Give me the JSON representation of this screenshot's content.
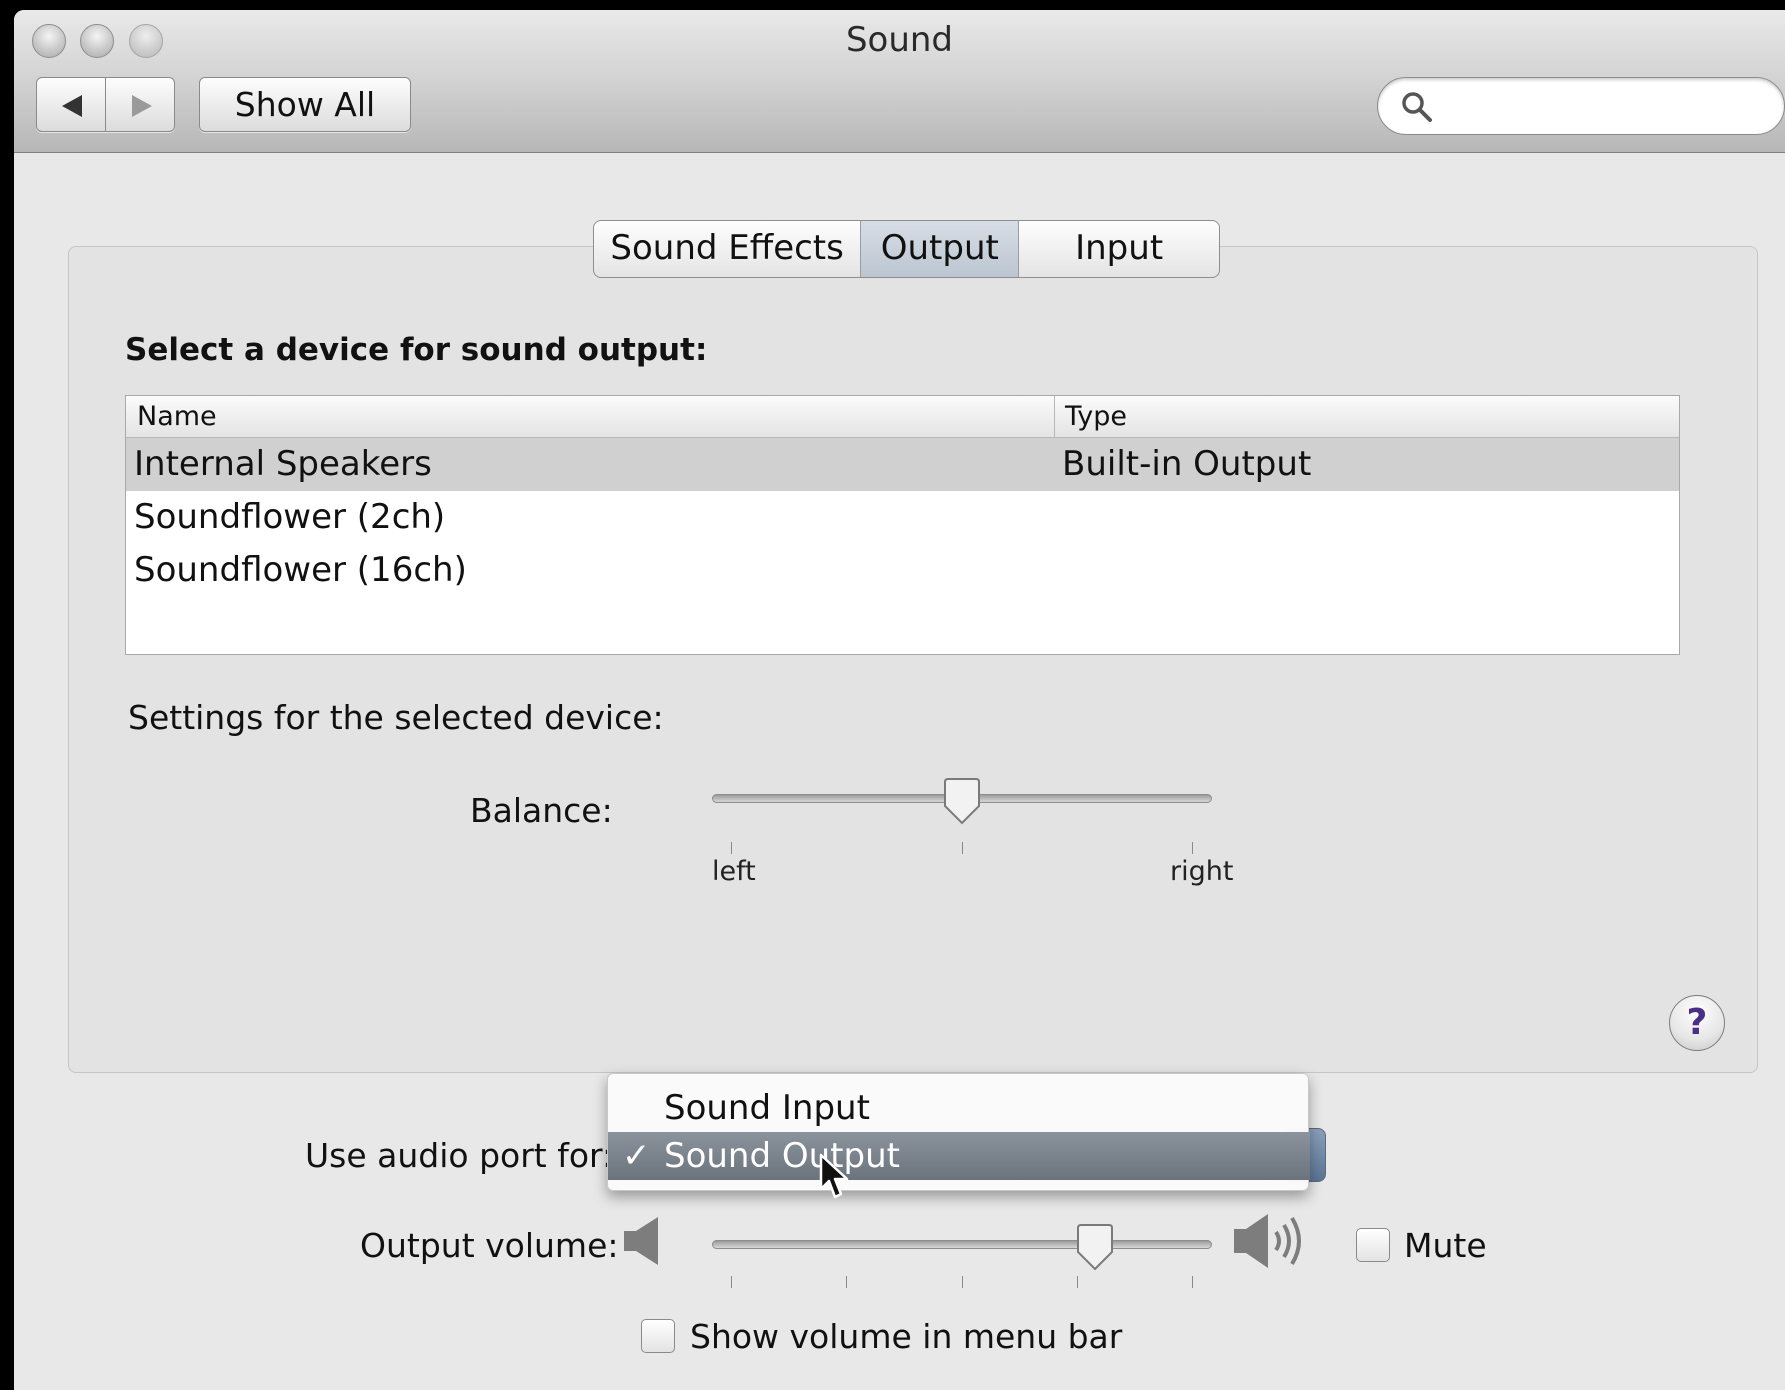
{
  "window": {
    "title": "Sound"
  },
  "toolbar": {
    "show_all_label": "Show All",
    "search_placeholder": ""
  },
  "tabs": [
    {
      "label": "Sound Effects",
      "selected": false
    },
    {
      "label": "Output",
      "selected": true
    },
    {
      "label": "Input",
      "selected": false
    }
  ],
  "output": {
    "section_title": "Select a device for sound output:",
    "columns": [
      "Name",
      "Type"
    ],
    "devices": [
      {
        "name": "Internal Speakers",
        "type": "Built-in Output",
        "selected": true
      },
      {
        "name": "Soundflower (2ch)",
        "type": "",
        "selected": false
      },
      {
        "name": "Soundflower (16ch)",
        "type": "",
        "selected": false
      }
    ],
    "settings_label": "Settings for the selected device:",
    "balance": {
      "label": "Balance:",
      "left_label": "left",
      "right_label": "right",
      "value": 0.5
    }
  },
  "help": {
    "glyph": "?"
  },
  "audio_port": {
    "label": "Use audio port for:",
    "menu": [
      {
        "label": "Sound Input",
        "checked": false,
        "highlighted": false
      },
      {
        "label": "Sound Output",
        "checked": true,
        "highlighted": true
      }
    ],
    "check_glyph": "✓"
  },
  "volume": {
    "label": "Output volume:",
    "value": 0.79,
    "mute_label": "Mute",
    "mute_checked": false,
    "show_in_menu_bar_label": "Show volume in menu bar",
    "show_in_menu_bar_checked": false
  },
  "colors": {
    "window_bg": "#e8e8e8",
    "selected_row": "#d0d0d0",
    "menu_highlight": "#7a828b",
    "help_glyph": "#4b2f86"
  }
}
